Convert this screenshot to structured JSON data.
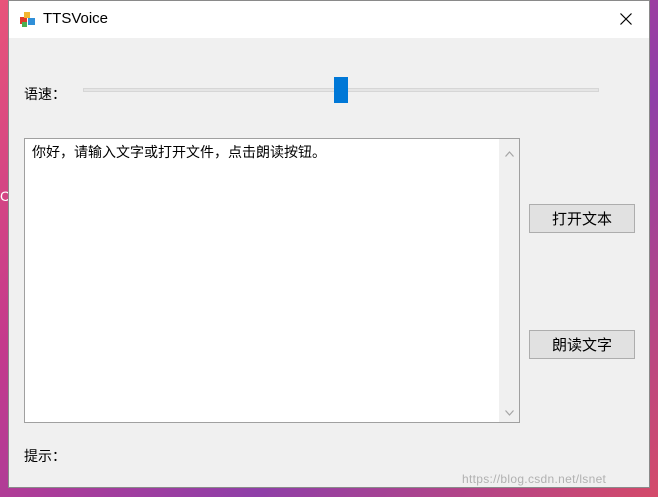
{
  "window": {
    "title": "TTSVoice",
    "app_icon": "tts-app-icon",
    "close_icon": "close-icon"
  },
  "speed": {
    "label": "语速：",
    "slider_value_fraction": 0.5
  },
  "editor": {
    "text": "你好，请输入文字或打开文件，点击朗读按钮。"
  },
  "buttons": {
    "open_label": "打开文本",
    "read_label": "朗读文字"
  },
  "hint": {
    "label": "提示："
  },
  "desktop": {
    "edge_glyph": "C"
  },
  "watermark": "https://blog.csdn.net/lsnet",
  "colors": {
    "accent": "#0078d7",
    "window_bg": "#f0f0f0",
    "button_bg": "#e1e1e1"
  }
}
